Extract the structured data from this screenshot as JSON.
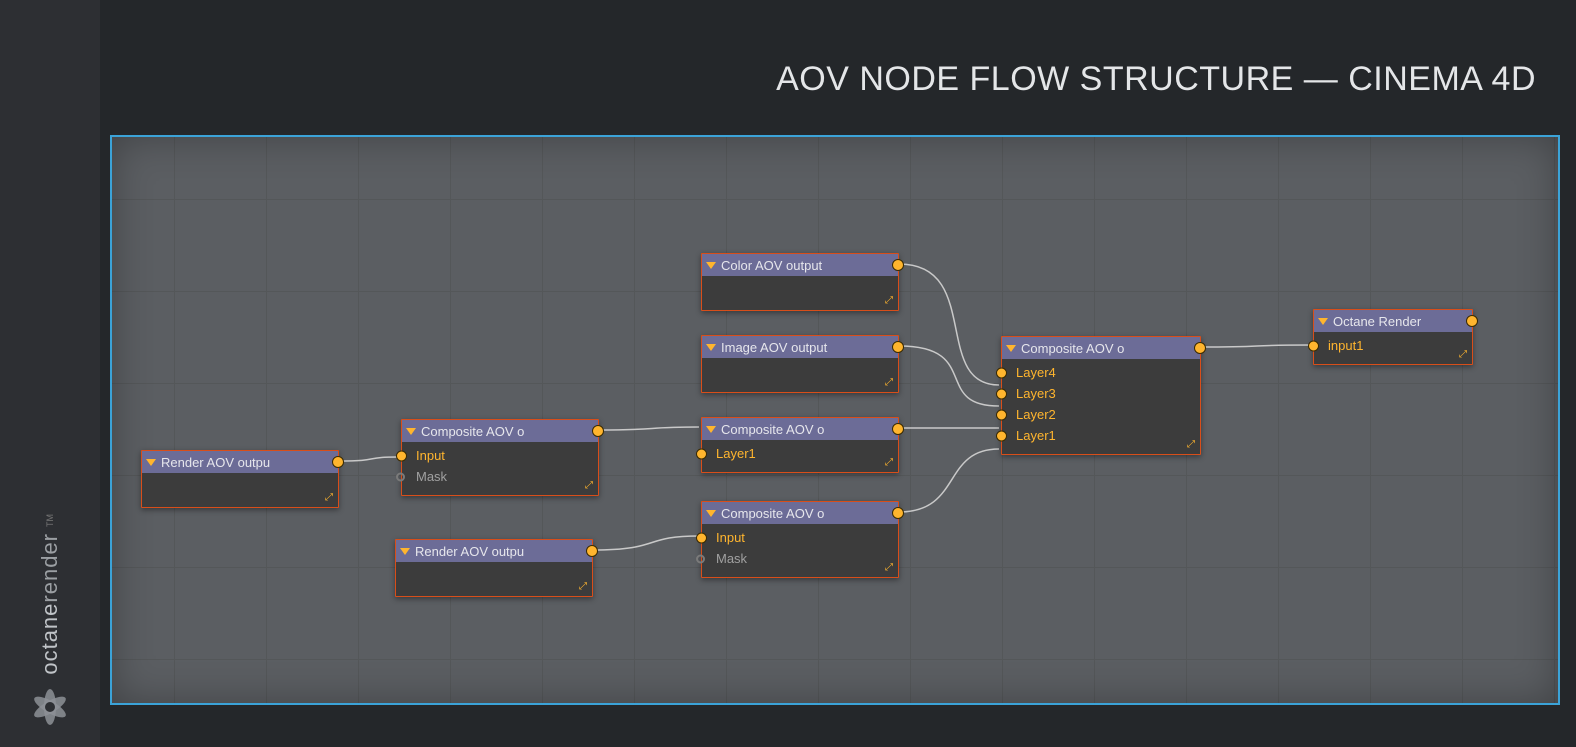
{
  "title": "AOV NODE FLOW STRUCTURE — CINEMA 4D",
  "brand": {
    "line1": "octane",
    "line2": "render",
    "tm": "TM"
  },
  "nodes": {
    "render_aov_1": {
      "title": "Render AOV outpu"
    },
    "composite_1": {
      "title": "Composite AOV o",
      "rows": {
        "input": "Input",
        "mask": "Mask"
      }
    },
    "render_aov_2": {
      "title": "Render AOV outpu"
    },
    "color_aov": {
      "title": "Color AOV output"
    },
    "image_aov": {
      "title": "Image AOV output"
    },
    "composite_2": {
      "title": "Composite AOV o",
      "rows": {
        "layer1": "Layer1"
      }
    },
    "composite_3": {
      "title": "Composite AOV o",
      "rows": {
        "input": "Input",
        "mask": "Mask"
      }
    },
    "composite_4": {
      "title": "Composite AOV o",
      "rows": {
        "layer4": "Layer4",
        "layer3": "Layer3",
        "layer2": "Layer2",
        "layer1": "Layer1"
      }
    },
    "octane_render": {
      "title": "Octane Render",
      "rows": {
        "input1": "input1"
      }
    }
  }
}
